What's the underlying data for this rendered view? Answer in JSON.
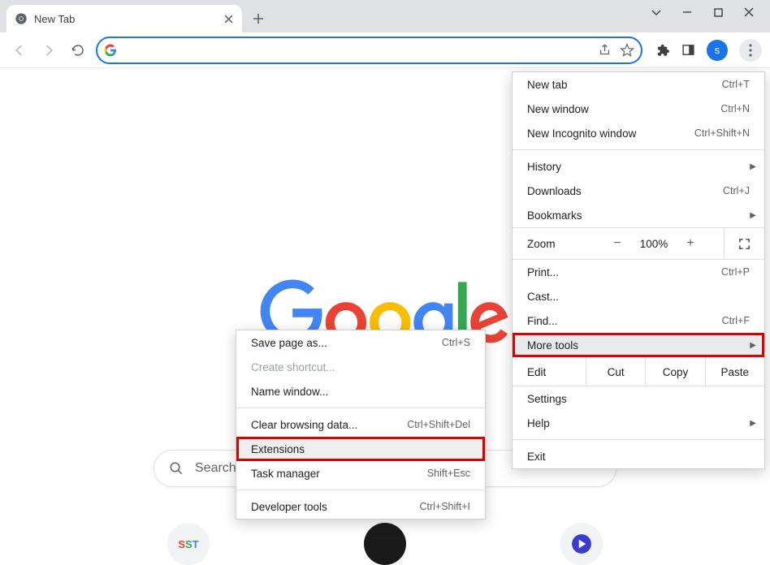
{
  "tab": {
    "title": "New Tab"
  },
  "searchbox": {
    "placeholder": "Search Google or type a URL",
    "visible_text": "Search G"
  },
  "avatar": {
    "letter": "s"
  },
  "chips": [
    "SST",
    ""
  ],
  "main_menu": {
    "new_tab": {
      "label": "New tab",
      "shortcut": "Ctrl+T"
    },
    "new_window": {
      "label": "New window",
      "shortcut": "Ctrl+N"
    },
    "incognito": {
      "label": "New Incognito window",
      "shortcut": "Ctrl+Shift+N"
    },
    "history": {
      "label": "History"
    },
    "downloads": {
      "label": "Downloads",
      "shortcut": "Ctrl+J"
    },
    "bookmarks": {
      "label": "Bookmarks"
    },
    "zoom": {
      "label": "Zoom",
      "value": "100%"
    },
    "print": {
      "label": "Print...",
      "shortcut": "Ctrl+P"
    },
    "cast": {
      "label": "Cast..."
    },
    "find": {
      "label": "Find...",
      "shortcut": "Ctrl+F"
    },
    "more_tools": {
      "label": "More tools"
    },
    "edit": {
      "label": "Edit",
      "cut": "Cut",
      "copy": "Copy",
      "paste": "Paste"
    },
    "settings": {
      "label": "Settings"
    },
    "help": {
      "label": "Help"
    },
    "exit": {
      "label": "Exit"
    }
  },
  "sub_menu": {
    "save_page": {
      "label": "Save page as...",
      "shortcut": "Ctrl+S"
    },
    "create_shortcut": {
      "label": "Create shortcut..."
    },
    "name_window": {
      "label": "Name window..."
    },
    "clear_data": {
      "label": "Clear browsing data...",
      "shortcut": "Ctrl+Shift+Del"
    },
    "extensions": {
      "label": "Extensions"
    },
    "task_manager": {
      "label": "Task manager",
      "shortcut": "Shift+Esc"
    },
    "dev_tools": {
      "label": "Developer tools",
      "shortcut": "Ctrl+Shift+I"
    }
  }
}
